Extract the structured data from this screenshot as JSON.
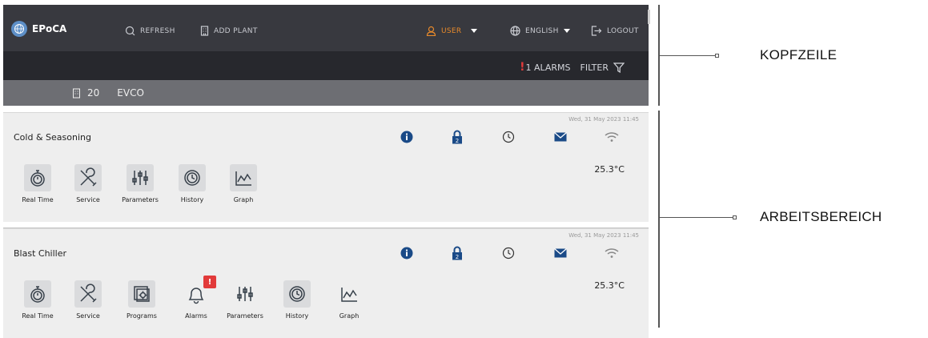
{
  "header": {
    "app_name": "EPoCA",
    "refresh_label": "REFRESH",
    "add_plant_label": "ADD PLANT",
    "user_label": "USER",
    "language_label": "ENGLISH",
    "logout_label": "LOGOUT",
    "alarms_exclamation": "!",
    "alarms_label": "1 ALARMS",
    "filter_label": "FILTER"
  },
  "plant": {
    "number": "20",
    "name": "EVCO"
  },
  "devices": [
    {
      "name": "Cold & Seasoning",
      "timestamp": "Wed, 31 May 2023 11:45",
      "temperature": "25.3°C",
      "tiles": [
        {
          "label": "Real Time",
          "icon": "stopwatch-icon"
        },
        {
          "label": "Service",
          "icon": "wrench-screwdriver-icon"
        },
        {
          "label": "Parameters",
          "icon": "sliders-icon"
        },
        {
          "label": "History",
          "icon": "history-icon"
        },
        {
          "label": "Graph",
          "icon": "graph-icon"
        }
      ]
    },
    {
      "name": "Blast Chiller",
      "timestamp": "Wed, 31 May 2023 11:45",
      "temperature": "25.3°C",
      "alarm_badge": "!",
      "tiles": [
        {
          "label": "Real Time",
          "icon": "stopwatch-icon"
        },
        {
          "label": "Service",
          "icon": "wrench-screwdriver-icon"
        },
        {
          "label": "Programs",
          "icon": "programs-icon"
        },
        {
          "label": "Alarms",
          "icon": "bell-icon"
        },
        {
          "label": "Parameters",
          "icon": "sliders-icon"
        },
        {
          "label": "History",
          "icon": "history-icon"
        },
        {
          "label": "Graph",
          "icon": "graph-icon"
        }
      ]
    }
  ],
  "status_icons": [
    "info-icon",
    "lock-icon",
    "clock-icon",
    "mail-icon",
    "wifi-icon"
  ],
  "lock_level": "2",
  "annotations": {
    "header": "KOPFZEILE",
    "workspace": "ARBEITSBEREICH"
  },
  "colors": {
    "header_bg": "#38393f",
    "alarm_bar_bg": "#27282d",
    "plant_bar_bg": "#6d6e73",
    "user_accent": "#e88a2b",
    "alarm_red": "#e23a3a",
    "icon_blue": "#1a4a87",
    "panel_bg": "#eeeeee"
  }
}
